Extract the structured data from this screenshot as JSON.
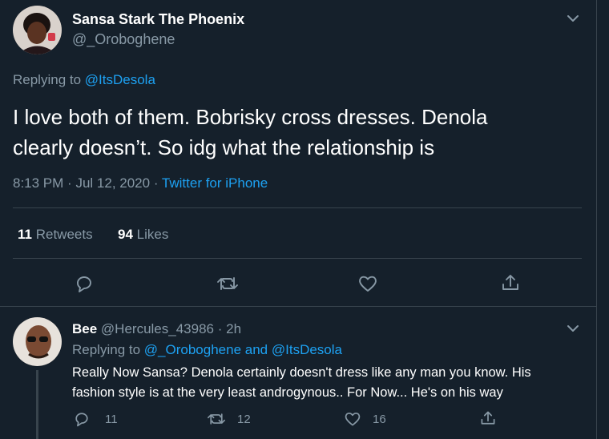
{
  "tweet": {
    "author_name": "Sansa Stark The Phoenix",
    "author_handle": "@_Oroboghene",
    "replying_prefix": "Replying to",
    "replying_to": "@ItsDesola",
    "text_line1": "I love both of them. Bobrisky cross dresses. Denola",
    "text_line2": "clearly doesn’t. So idg what the relationship is",
    "time": "8:13 PM",
    "date": "Jul 12, 2020",
    "source": "Twitter for iPhone",
    "sep": "·",
    "retweets_count": "11",
    "retweets_label": "Retweets",
    "likes_count": "94",
    "likes_label": "Likes"
  },
  "reply": {
    "author_name": "Bee",
    "author_handle": "@Hercules_43986",
    "sep": "·",
    "age": "2h",
    "replying_prefix": "Replying to",
    "replying_to_1": "@_Oroboghene",
    "replying_and": "and",
    "replying_to_2": "@ItsDesola",
    "text_line1": "Really Now Sansa? Denola certainly doesn't dress like any man you know. His",
    "text_line2": "fashion style is at the very least androgynous.. For Now... He's on his way",
    "reply_count": "11",
    "retweet_count": "12",
    "like_count": "16"
  },
  "icons": [
    "chevron-down-icon",
    "reply-icon",
    "retweet-icon",
    "like-icon",
    "share-icon"
  ],
  "colors": {
    "background": "#15202b",
    "accent": "#1da1f2",
    "muted": "#8899a6",
    "divider": "#38444d"
  }
}
